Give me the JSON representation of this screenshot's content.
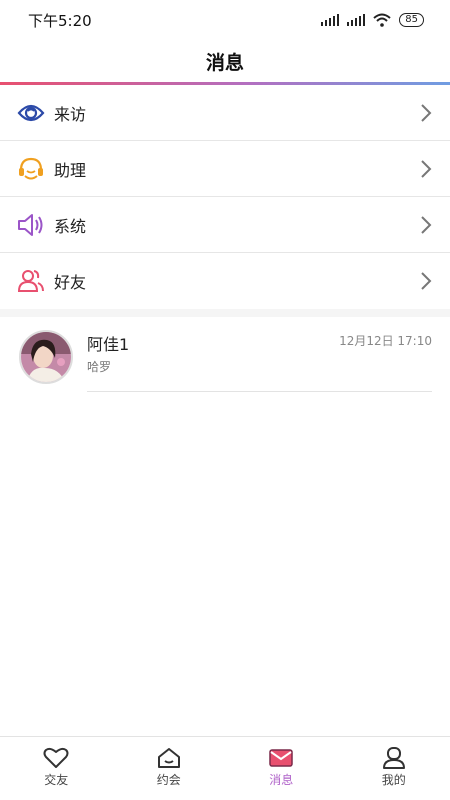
{
  "status_bar": {
    "time": "下午5:20",
    "battery": "85"
  },
  "header": {
    "title": "消息"
  },
  "menu": [
    {
      "label": "来访",
      "icon": "eye-icon",
      "color": "#2c4aa8"
    },
    {
      "label": "助理",
      "icon": "headset-icon",
      "color": "#f0a020"
    },
    {
      "label": "系统",
      "icon": "speaker-icon",
      "color": "#9b55c8"
    },
    {
      "label": "好友",
      "icon": "friends-icon",
      "color": "#e8506f"
    }
  ],
  "conversation": {
    "name": "阿佳1",
    "time": "12月12日 17:10",
    "message": "哈罗"
  },
  "bottom_nav": [
    {
      "label": "交友",
      "icon": "heart-icon",
      "active": false
    },
    {
      "label": "约会",
      "icon": "home-icon",
      "active": false
    },
    {
      "label": "消息",
      "icon": "mail-icon",
      "active": true
    },
    {
      "label": "我的",
      "icon": "user-icon",
      "active": false
    }
  ],
  "colors": {
    "accent": "#b063c9",
    "gradient_start": "#e8506f",
    "gradient_end": "#6f9de2"
  }
}
